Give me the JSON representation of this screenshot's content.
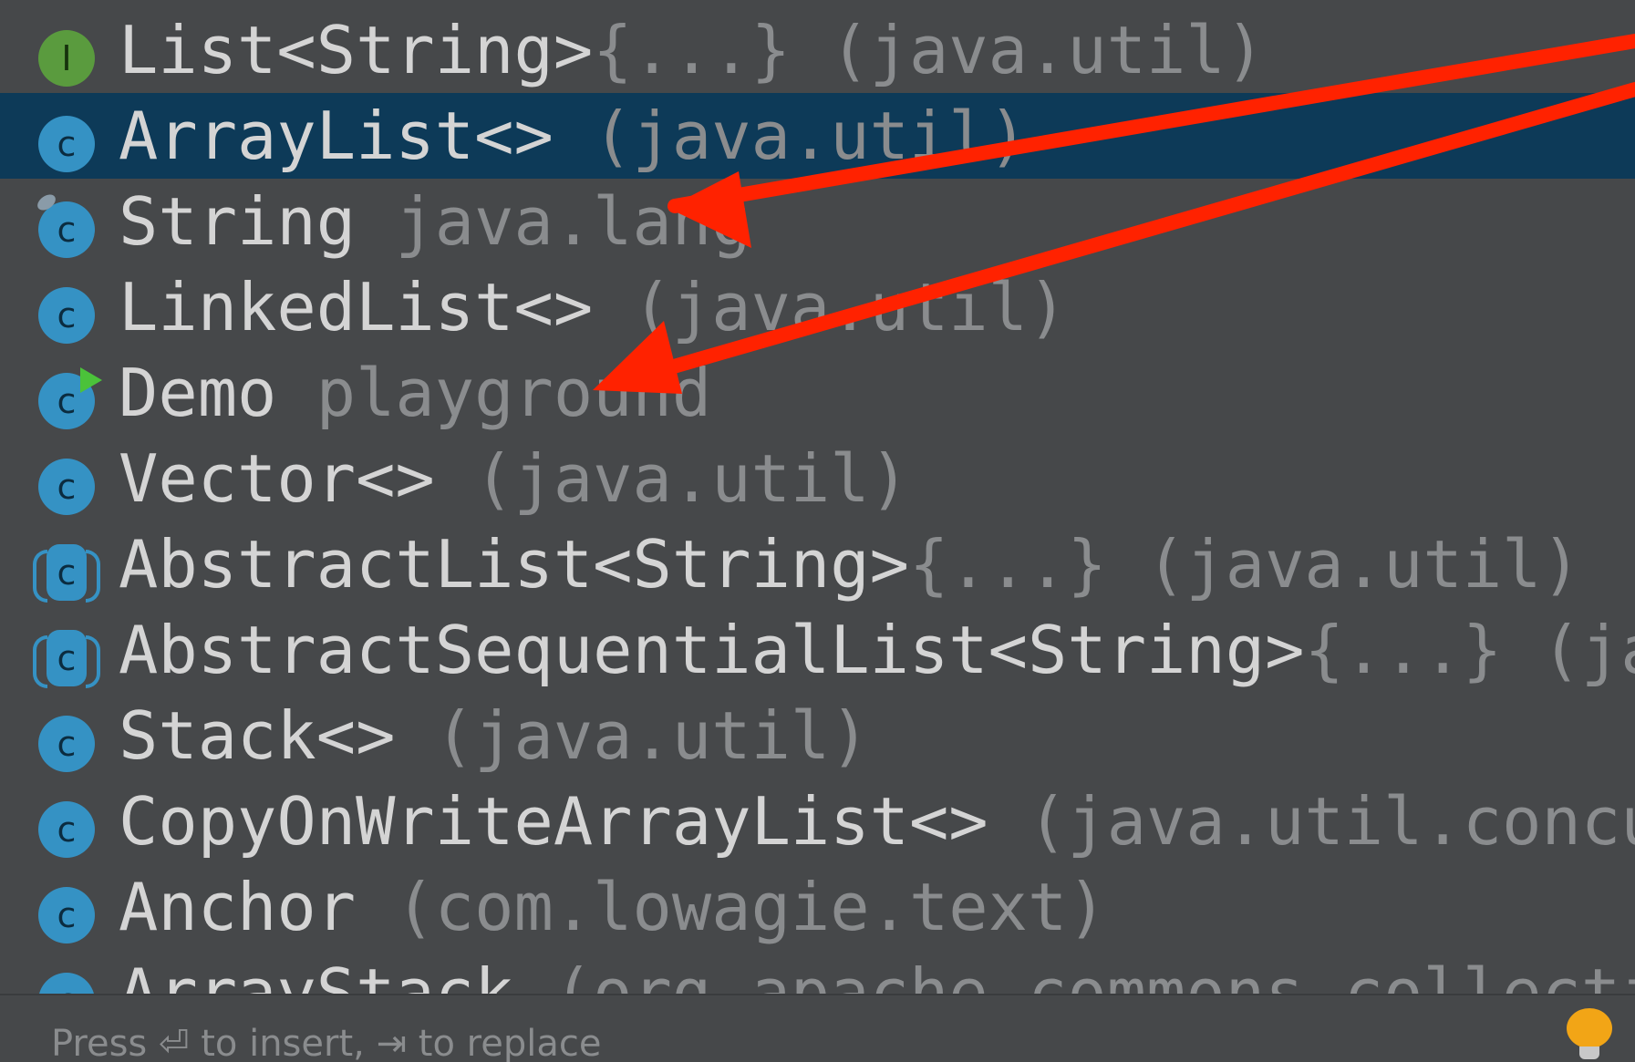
{
  "completion": {
    "items": [
      {
        "kind": "interface",
        "icon": "interface-icon",
        "glyph": "I",
        "name": "List<String>",
        "extra": "{...} (java.util)",
        "selected": false
      },
      {
        "kind": "class",
        "icon": "class-icon",
        "glyph": "c",
        "name": "ArrayList<>",
        "extra": " (java.util)",
        "selected": true
      },
      {
        "kind": "class-final",
        "icon": "final-class-icon",
        "glyph": "c",
        "name": "String",
        "extra": " java.lang",
        "selected": false
      },
      {
        "kind": "class",
        "icon": "class-icon",
        "glyph": "c",
        "name": "LinkedList<>",
        "extra": " (java.util)",
        "selected": false
      },
      {
        "kind": "class-runnable",
        "icon": "runnable-class-icon",
        "glyph": "c",
        "name": "Demo",
        "extra": " playground",
        "selected": false
      },
      {
        "kind": "class",
        "icon": "class-icon",
        "glyph": "c",
        "name": "Vector<>",
        "extra": " (java.util)",
        "selected": false
      },
      {
        "kind": "abstract",
        "icon": "abstract-class-icon",
        "glyph": "c",
        "name": "AbstractList<String>",
        "extra": "{...} (java.util)",
        "selected": false
      },
      {
        "kind": "abstract",
        "icon": "abstract-class-icon",
        "glyph": "c",
        "name": "AbstractSequentialList<String>",
        "extra": "{...} (ja…",
        "selected": false
      },
      {
        "kind": "class",
        "icon": "class-icon",
        "glyph": "c",
        "name": "Stack<>",
        "extra": " (java.util)",
        "selected": false
      },
      {
        "kind": "class",
        "icon": "class-icon",
        "glyph": "c",
        "name": "CopyOnWriteArrayList<>",
        "extra": " (java.util.concu…",
        "selected": false
      },
      {
        "kind": "class",
        "icon": "class-icon",
        "glyph": "c",
        "name": "Anchor",
        "extra": " (com.lowagie.text)",
        "selected": false
      },
      {
        "kind": "class",
        "icon": "class-icon",
        "glyph": "c",
        "name": "ArrayStack",
        "extra": " (org.apache.commons.collecti…",
        "selected": false
      }
    ],
    "footer": {
      "hint": "Press ⏎ to insert, ⇥ to replace",
      "bulb_icon": "lightbulb-icon"
    }
  },
  "annotation": {
    "arrow_color": "#ff2200",
    "arrow_icon": "annotation-arrow"
  },
  "colors": {
    "popup_bg": "#46484a",
    "selection_bg": "#0d3a58",
    "class_icon": "#3592c4",
    "interface_icon": "#5a9b3e",
    "text": "#d4d4d4",
    "text_dim": "#8a8c8e",
    "bulb": "#f2a516"
  }
}
